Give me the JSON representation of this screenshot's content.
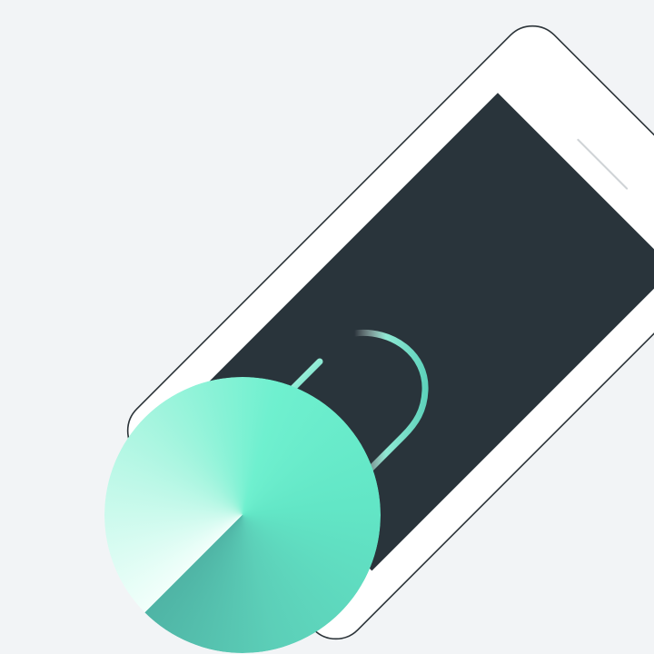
{
  "scene": {
    "background": "#f2f4f6",
    "phone": {
      "outline_color": "#2b3338",
      "screen_color": "#29343b",
      "earpiece_color": "#cfd3d6"
    },
    "cable": {
      "color_light": "#aef7e2",
      "color_main": "#5fd3bc"
    },
    "charger_disc": {
      "colors": [
        "#f2fffb",
        "#a6f5df",
        "#6ff0cf",
        "#62e6c6",
        "#5ccfb8",
        "#4fb4a5"
      ]
    }
  }
}
